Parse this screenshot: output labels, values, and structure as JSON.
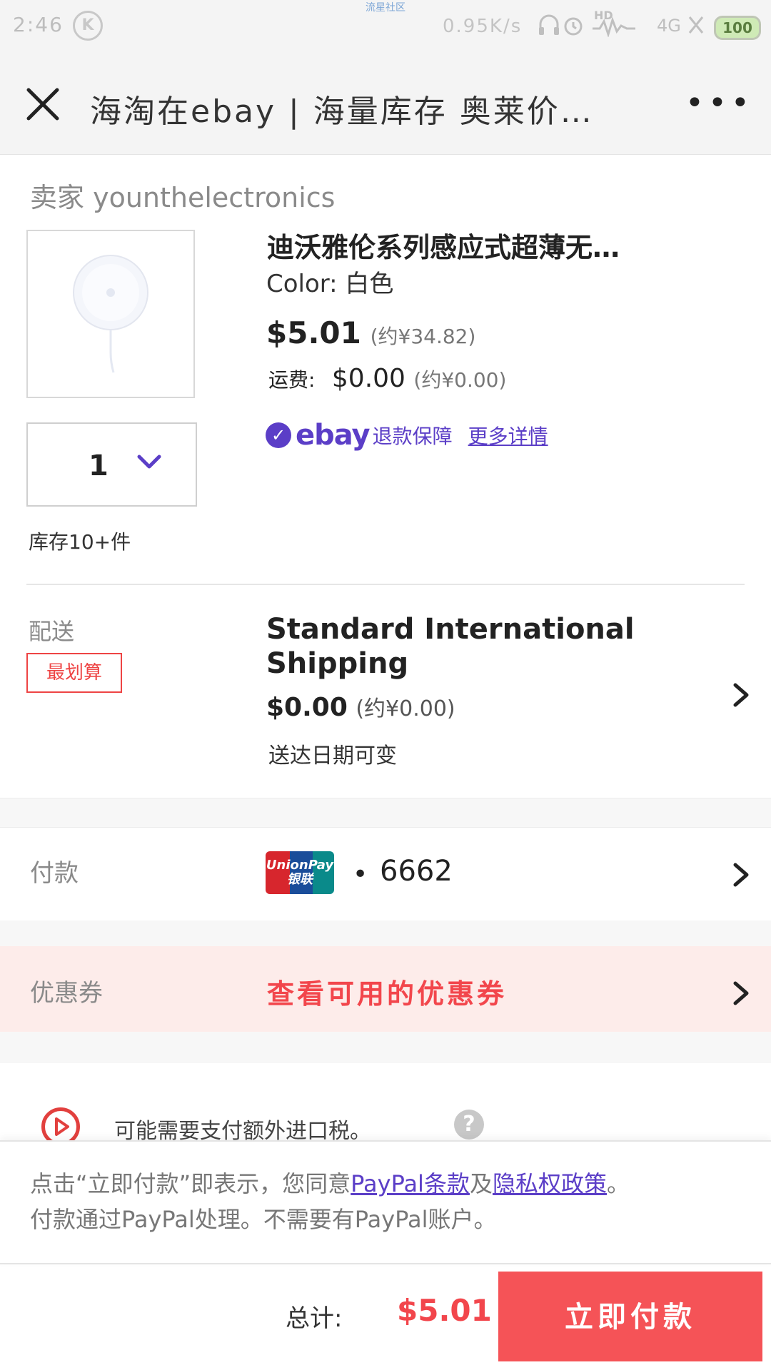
{
  "status_bar": {
    "time": "2:46",
    "k_badge": "K",
    "center_text": "流星社区",
    "net_speed": "0.95K/s",
    "hd": "HD",
    "network": "4G",
    "battery": "100"
  },
  "header": {
    "title": "海淘在ebay | 海量库存 奥莱价…",
    "more": "•••"
  },
  "order": {
    "seller": "卖家 younthelectronics",
    "product_title": "迪沃雅伦系列感应式超薄无…",
    "color_label": "Color: 白色",
    "price": "$5.01",
    "price_approx": "(约¥34.82)",
    "shipping_label": "运费:",
    "shipping_price": "$0.00",
    "shipping_approx": "(约¥0.00)",
    "ebay_logo": "ebay",
    "guarantee_text": "退款保障",
    "guarantee_link": "更多详情",
    "quantity": "1",
    "stock": "库存10+件"
  },
  "delivery": {
    "label": "配送",
    "tag": "最划算",
    "method": "Standard International Shipping",
    "cost": "$0.00",
    "cost_approx": "(约¥0.00)",
    "date": "送达日期可变"
  },
  "payment": {
    "label": "付款",
    "card_brand": "UnionPay 银联",
    "card_dot": "•",
    "card_number": "6662"
  },
  "coupon": {
    "label": "优惠券",
    "link": "查看可用的优惠券"
  },
  "tax_notice": {
    "text": "可能需要支付额外进口税。",
    "help": "?"
  },
  "agreement": {
    "prefix": "点击“立即付款”即表示，您同意",
    "paypal_terms": "PayPal条款",
    "and": "及",
    "privacy": "隐私权政策",
    "suffix": "。",
    "line2": "付款通过PayPal处理。不需要有PayPal账户。"
  },
  "footer": {
    "total_label": "总计:",
    "total_amount": "$5.01",
    "pay_button": "立即付款"
  },
  "colors": {
    "accent_purple": "#5b3ec7",
    "accent_red": "#f2464c",
    "button_red": "#f55357",
    "coupon_bg": "#fdecea"
  }
}
